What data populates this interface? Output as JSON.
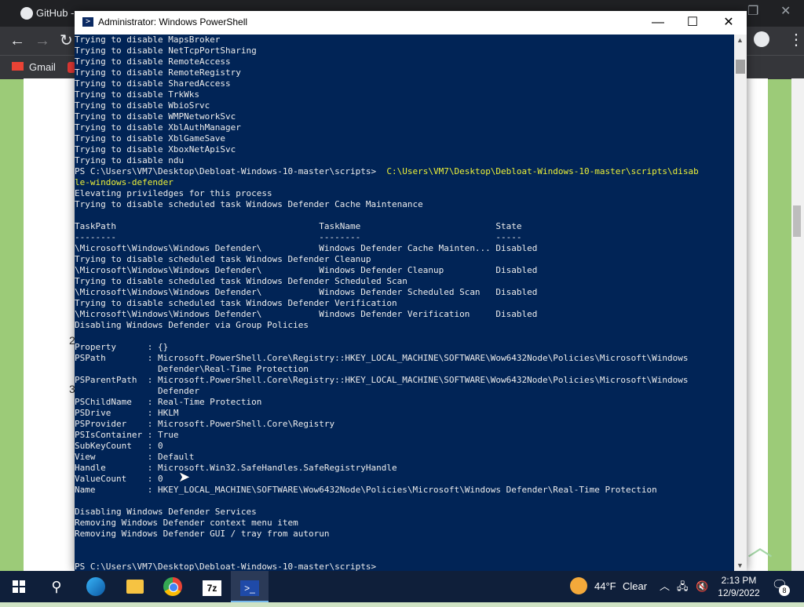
{
  "browser": {
    "tab_title": "GitHub - W",
    "bookmark_gmail": "Gmail"
  },
  "page_side_numbers": [
    "2",
    "3"
  ],
  "window": {
    "title": "Administrator: Windows PowerShell",
    "minimize": "—",
    "maximize": "☐",
    "close": "✕"
  },
  "console": {
    "lines": [
      {
        "text": "Trying to disable MapsBroker"
      },
      {
        "text": "Trying to disable NetTcpPortSharing"
      },
      {
        "text": "Trying to disable RemoteAccess"
      },
      {
        "text": "Trying to disable RemoteRegistry"
      },
      {
        "text": "Trying to disable SharedAccess"
      },
      {
        "text": "Trying to disable TrkWks"
      },
      {
        "text": "Trying to disable WbioSrvc"
      },
      {
        "text": "Trying to disable WMPNetworkSvc"
      },
      {
        "text": "Trying to disable XblAuthManager"
      },
      {
        "text": "Trying to disable XblGameSave"
      },
      {
        "text": "Trying to disable XboxNetApiSvc"
      },
      {
        "text": "Trying to disable ndu"
      },
      {
        "text": "PS C:\\Users\\VM7\\Desktop\\Debloat-Windows-10-master\\scripts>  ",
        "yellow": "C:\\Users\\VM7\\Desktop\\Debloat-Windows-10-master\\scripts\\disab"
      },
      {
        "text": "",
        "yellow": "le-windows-defender"
      },
      {
        "text": "Elevating priviledges for this process"
      },
      {
        "text": "Trying to disable scheduled task Windows Defender Cache Maintenance"
      },
      {
        "text": ""
      },
      {
        "text": "TaskPath                                       TaskName                          State"
      },
      {
        "text": "--------                                       --------                          -----"
      },
      {
        "text": "\\Microsoft\\Windows\\Windows Defender\\           Windows Defender Cache Mainten... Disabled"
      },
      {
        "text": "Trying to disable scheduled task Windows Defender Cleanup"
      },
      {
        "text": "\\Microsoft\\Windows\\Windows Defender\\           Windows Defender Cleanup          Disabled"
      },
      {
        "text": "Trying to disable scheduled task Windows Defender Scheduled Scan"
      },
      {
        "text": "\\Microsoft\\Windows\\Windows Defender\\           Windows Defender Scheduled Scan   Disabled"
      },
      {
        "text": "Trying to disable scheduled task Windows Defender Verification"
      },
      {
        "text": "\\Microsoft\\Windows\\Windows Defender\\           Windows Defender Verification     Disabled"
      },
      {
        "text": "Disabling Windows Defender via Group Policies"
      },
      {
        "text": ""
      },
      {
        "text": "Property      : {}"
      },
      {
        "text": "PSPath        : Microsoft.PowerShell.Core\\Registry::HKEY_LOCAL_MACHINE\\SOFTWARE\\Wow6432Node\\Policies\\Microsoft\\Windows"
      },
      {
        "text": "                Defender\\Real-Time Protection"
      },
      {
        "text": "PSParentPath  : Microsoft.PowerShell.Core\\Registry::HKEY_LOCAL_MACHINE\\SOFTWARE\\Wow6432Node\\Policies\\Microsoft\\Windows"
      },
      {
        "text": "                Defender"
      },
      {
        "text": "PSChildName   : Real-Time Protection"
      },
      {
        "text": "PSDrive       : HKLM"
      },
      {
        "text": "PSProvider    : Microsoft.PowerShell.Core\\Registry"
      },
      {
        "text": "PSIsContainer : True"
      },
      {
        "text": "SubKeyCount   : 0"
      },
      {
        "text": "View          : Default"
      },
      {
        "text": "Handle        : Microsoft.Win32.SafeHandles.SafeRegistryHandle"
      },
      {
        "text": "ValueCount    : 0"
      },
      {
        "text": "Name          : HKEY_LOCAL_MACHINE\\SOFTWARE\\Wow6432Node\\Policies\\Microsoft\\Windows Defender\\Real-Time Protection"
      },
      {
        "text": ""
      },
      {
        "text": "Disabling Windows Defender Services"
      },
      {
        "text": "Removing Windows Defender context menu item"
      },
      {
        "text": "Removing Windows Defender GUI / tray from autorun"
      },
      {
        "text": ""
      },
      {
        "text": ""
      },
      {
        "text": "PS C:\\Users\\VM7\\Desktop\\Debloat-Windows-10-master\\scripts>"
      }
    ]
  },
  "taskbar": {
    "weather_temp": "44°F",
    "weather_desc": "Clear",
    "time": "2:13 PM",
    "date": "12/9/2022",
    "notification_count": "8"
  },
  "colors": {
    "console_bg": "#012456",
    "console_text": "#ececec",
    "command_yellow": "#ecf038",
    "taskbar_bg": "#0f1f3a"
  }
}
